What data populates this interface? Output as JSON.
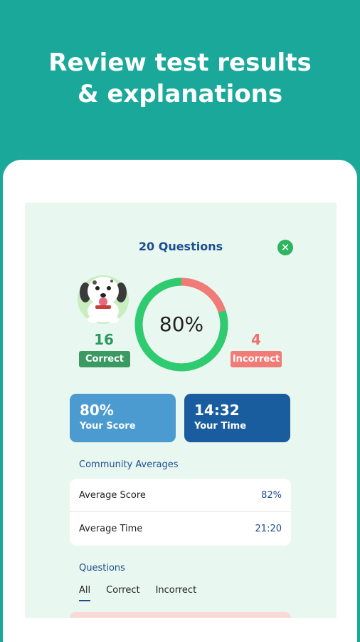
{
  "headline": {
    "line1": "Review test results",
    "line2": "& explanations"
  },
  "summary": {
    "questions_label": "20 Questions",
    "percent": "80%",
    "score_fraction": 0.8,
    "correct_count": "16",
    "correct_label": "Correct",
    "incorrect_count": "4",
    "incorrect_label": "Incorrect"
  },
  "cards": {
    "score_value": "80%",
    "score_caption": "Your Score",
    "time_value": "14:32",
    "time_caption": "Your Time"
  },
  "community": {
    "title": "Community Averages",
    "rows": [
      {
        "label": "Average Score",
        "value": "82%"
      },
      {
        "label": "Average Time",
        "value": "21:20"
      }
    ]
  },
  "questions": {
    "title": "Questions",
    "tabs": [
      "All",
      "Correct",
      "Incorrect"
    ],
    "active_tab": "All"
  },
  "colors": {
    "background": "#1aa89a",
    "correct": "#2ecc71",
    "incorrect": "#f07b77",
    "accent_blue": "#1d4d8f"
  },
  "icons": {
    "close": "close-icon",
    "mascot": "dalmatian-puppy-icon"
  }
}
